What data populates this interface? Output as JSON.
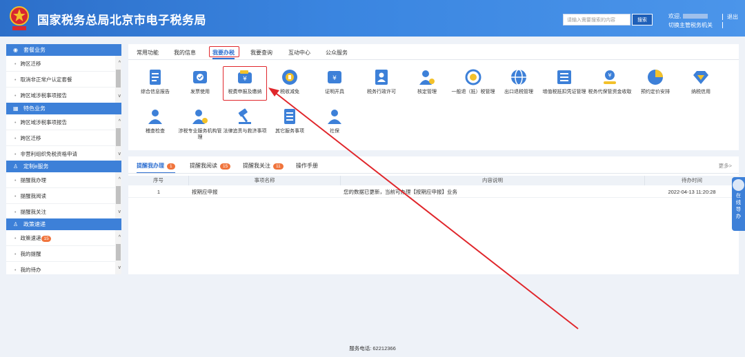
{
  "header": {
    "title": "国家税务总局北京市电子税务局",
    "search_placeholder": "请输入需要搜索的内容",
    "search_button": "搜索",
    "welcome": "欢迎,",
    "switch_org": "切换主管税务机关",
    "logout": "退出",
    "brand_color": "#3a85e0"
  },
  "sidebar": {
    "sections": [
      {
        "title": "套餐业务",
        "icon": "package-icon",
        "items": [
          "跨区迁移",
          "取消非正常户认定套餐",
          "跨区域涉税事项报告"
        ]
      },
      {
        "title": "特色业务",
        "icon": "grid-icon",
        "items": [
          "跨区域涉税事项报告",
          "跨区迁移",
          "非营利组织免税资格申请"
        ]
      },
      {
        "title": "定制e服务",
        "icon": "user-icon",
        "items": [
          "提醒我办理",
          "提醒我阅读",
          "提醒我关注"
        ]
      },
      {
        "title": "政策速递",
        "icon": "user-icon",
        "items": [
          "政策速递",
          "我的提醒",
          "我的待办"
        ],
        "badge": "15"
      }
    ]
  },
  "main": {
    "tabs": [
      "常用功能",
      "我的信息",
      "我要办税",
      "我要查询",
      "互动中心",
      "公众服务"
    ],
    "active_tab": "我要办税",
    "grid_row1": [
      {
        "label": "综合信息报告",
        "icon": "document-icon"
      },
      {
        "label": "发票使用",
        "icon": "invoice-icon"
      },
      {
        "label": "税费申报及缴纳",
        "icon": "wallet-icon"
      },
      {
        "label": "税收减免",
        "icon": "coin-icon"
      },
      {
        "label": "证明开具",
        "icon": "certificate-icon"
      },
      {
        "label": "税务行政许可",
        "icon": "person-card-icon"
      },
      {
        "label": "核定管理",
        "icon": "person-gear-icon"
      },
      {
        "label": "一般退（抵）税管理",
        "icon": "refund-icon"
      },
      {
        "label": "出口退税管理",
        "icon": "globe-icon"
      },
      {
        "label": "增值税抵扣凭证管理",
        "icon": "receipt-icon"
      },
      {
        "label": "税务代保管资金收取",
        "icon": "money-hand-icon"
      },
      {
        "label": "预约定价安排",
        "icon": "pie-icon"
      },
      {
        "label": "纳税信用",
        "icon": "diamond-icon"
      }
    ],
    "grid_row2": [
      {
        "label": "稽查检查",
        "icon": "person-icon"
      },
      {
        "label": "涉税专业服务机构管理",
        "icon": "person-gear-icon"
      },
      {
        "label": "法律追责与救济事项",
        "icon": "gavel-icon"
      },
      {
        "label": "其它服务事项",
        "icon": "list-icon"
      },
      {
        "label": "社保",
        "icon": "people-icon"
      }
    ]
  },
  "reminders": {
    "tabs": [
      {
        "label": "提醒我办理",
        "badge": "1"
      },
      {
        "label": "提醒我阅读",
        "badge": "15"
      },
      {
        "label": "提醒我关注",
        "badge": "11"
      },
      {
        "label": "操作手册",
        "badge": ""
      }
    ],
    "more": "更多>",
    "columns": [
      "序号",
      "事项名称",
      "内容说明",
      "待办时间"
    ],
    "rows": [
      {
        "no": "1",
        "name": "按期应申报",
        "desc": "您的数据已更新，当前可办理【按期应申报】业务",
        "time": "2022-04-13 11:20:28"
      }
    ]
  },
  "float_guide": {
    "label": "在线导办"
  },
  "footer": {
    "phone": "服务电话: 62212366"
  },
  "annotation_color": "#e0262b"
}
